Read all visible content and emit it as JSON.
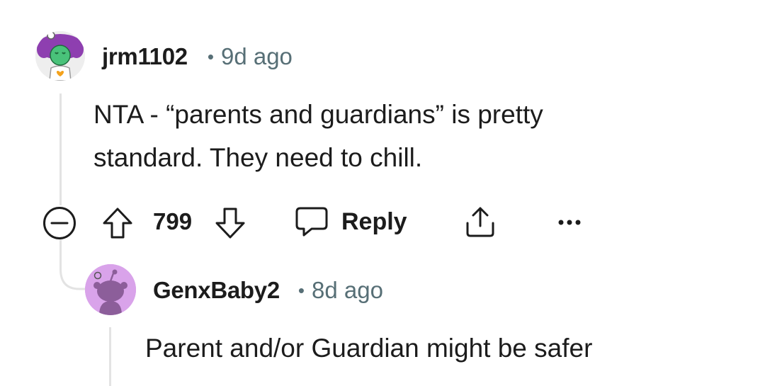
{
  "comments": [
    {
      "username": "jrm1102",
      "separator": "•",
      "time": "9d ago",
      "body_lines": [
        "NTA - “parents and guardians” is pretty",
        "standard. They need to chill."
      ],
      "avatar_icon": "avatar-green-purple-hair-icon"
    },
    {
      "username": "GenxBaby2",
      "separator": "•",
      "time": "8d ago",
      "body_lines": [
        "Parent and/or Guardian might be safer"
      ],
      "avatar_icon": "avatar-default-snoo-icon"
    }
  ],
  "actions": {
    "collapse_icon": "minus-circle-icon",
    "upvote_icon": "arrow-up-icon",
    "vote_count": "799",
    "downvote_icon": "arrow-down-icon",
    "reply_icon": "speech-bubble-icon",
    "reply_label": "Reply",
    "share_icon": "share-icon",
    "more_icon": "ellipsis-icon"
  },
  "colors": {
    "text": "#1c1c1c",
    "meta": "#576f76",
    "thread_line": "#e3e3e3",
    "avatar2_bg": "#d9a3ea"
  }
}
